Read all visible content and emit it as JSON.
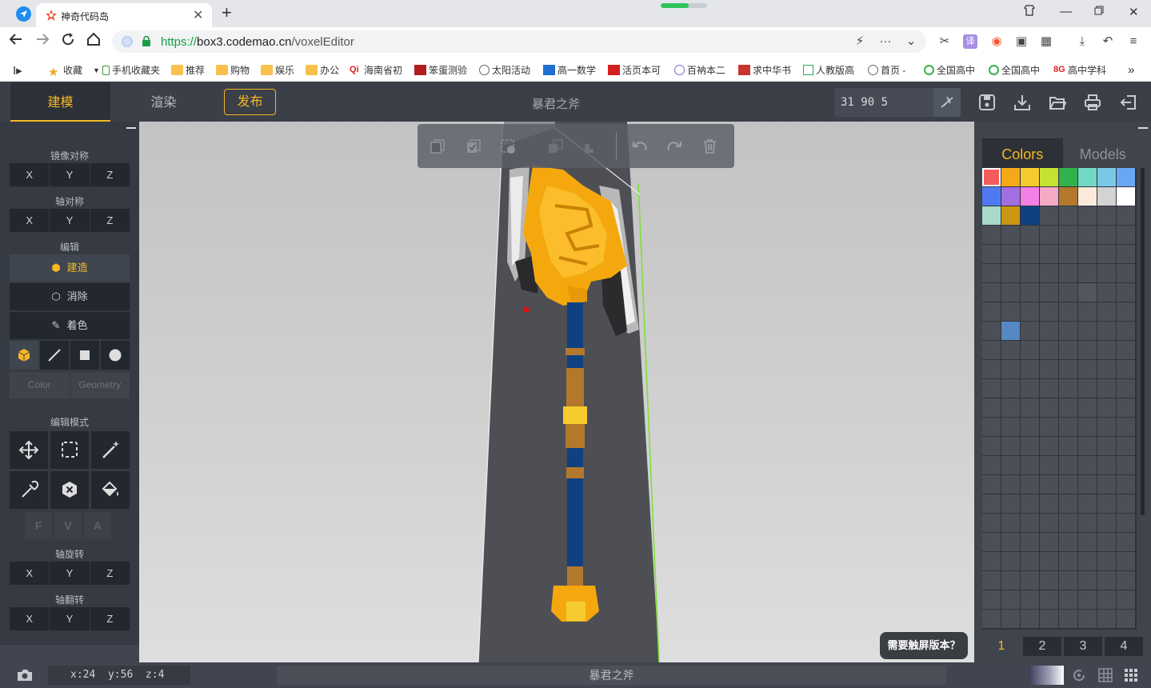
{
  "browser": {
    "tab_title": "神奇代码岛",
    "url_scheme": "https://",
    "url_domain": "box3.codemao.cn",
    "url_path": "/voxelEditor",
    "download_progress": 0.6,
    "bookmarks": [
      "收藏",
      "手机收藏夹",
      "推荐",
      "购物",
      "娱乐",
      "办公",
      "海南省初",
      "笨蛋测验",
      "太阳活动",
      "高一数学",
      "活页本可",
      "百衲本二",
      "求中华书",
      "人教版高",
      "首页 -",
      "全国高中",
      "全国高中",
      "高中学科"
    ],
    "bookmark_more": "»"
  },
  "editor": {
    "mode_tabs": [
      "建模",
      "渲染"
    ],
    "active_mode": "建模",
    "publish_label": "发布",
    "project_title": "暴君之斧",
    "dimensions": "31  90  5",
    "left": {
      "mirror_label": "镜像对称",
      "axis_sym_label": "轴对称",
      "edit_label": "编辑",
      "build_label": "建造",
      "erase_label": "消除",
      "paint_label": "着色",
      "color_label": "Color",
      "geometry_label": "Geometry",
      "edit_mode_label": "编辑模式",
      "fva": [
        "F",
        "V",
        "A"
      ],
      "axis_rotate_label": "轴旋转",
      "axis_flip_label": "轴翻转",
      "axes": [
        "X",
        "Y",
        "Z"
      ]
    },
    "right": {
      "tabs": [
        "Colors",
        "Models"
      ],
      "active_tab": "Colors",
      "palette_colors": [
        "#f45b5b",
        "#f5a818",
        "#f5cb30",
        "#c5e232",
        "#2fb34a",
        "#72d9c6",
        "#7ac8e8",
        "#68a7f4",
        "#4f79f2",
        "#a36ee0",
        "#f47fe5",
        "#f5a9c4",
        "#b3782c",
        "#fbeadb",
        "#d3d3d3",
        "#ffffff",
        "#a9d9c9",
        "#cc9710",
        "#0f4182"
      ],
      "extra_cells": [
        {
          "index": 53,
          "color": "#51565f"
        },
        {
          "index": 65,
          "color": "#5489c4"
        }
      ],
      "pages": [
        "1",
        "2",
        "3",
        "4"
      ],
      "active_page": "1"
    },
    "touch_prompt": "需要触屏版本？",
    "coords": "x:24  y:56  z:4",
    "status_title": "暴君之斧"
  }
}
